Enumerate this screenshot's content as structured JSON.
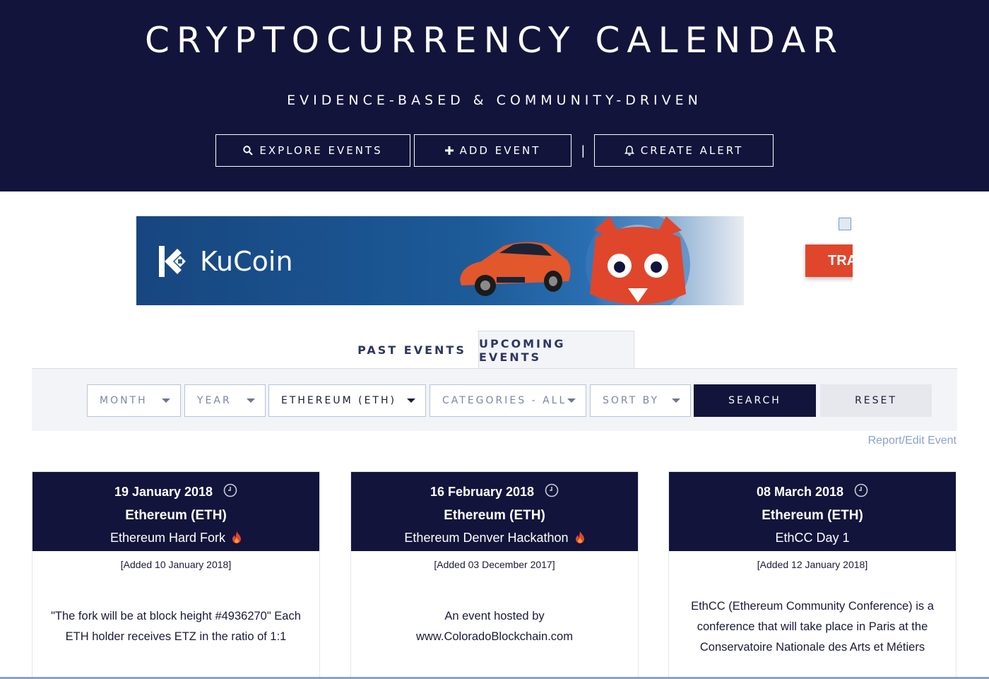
{
  "header": {
    "title": "CRYPTOCURRENCY CALENDAR",
    "subtitle": "EVIDENCE-BASED & COMMUNITY-DRIVEN",
    "buttons": [
      {
        "label": "EXPLORE EVENTS",
        "icon": "search-icon"
      },
      {
        "label": "ADD EVENT",
        "icon": "plus-icon"
      },
      {
        "label": "CREATE ALERT",
        "icon": "bell-icon"
      }
    ],
    "separator": "|",
    "colors": {
      "background": "#13143b",
      "text": "#ffffff"
    }
  },
  "ad": {
    "brand": "KuCoin",
    "cta": "TRA",
    "colors": {
      "blue": "#1c5a98",
      "cta": "#e0462b"
    }
  },
  "tabs": [
    {
      "label": "PAST EVENTS",
      "active": false
    },
    {
      "label": "UPCOMING EVENTS",
      "active": true
    }
  ],
  "filters": {
    "month": "MONTH",
    "year": "YEAR",
    "coin": "ETHEREUM (ETH)",
    "categories": "CATEGORIES - ALL",
    "sort": "SORT BY",
    "search_label": "SEARCH",
    "reset_label": "RESET"
  },
  "report_link": "Report/Edit Event",
  "cards": [
    {
      "date": "19 January 2018",
      "coin": "Ethereum (ETH)",
      "event": "Ethereum Hard Fork",
      "hot": true,
      "added": "[Added 10 January 2018]",
      "description": "\"The fork will be at block height #4936270\" Each ETH holder receives ETZ in the ratio of 1:1"
    },
    {
      "date": "16 February 2018",
      "coin": "Ethereum (ETH)",
      "event": "Ethereum Denver Hackathon",
      "hot": true,
      "added": "[Added 03 December 2017]",
      "description": "An event hosted by www.ColoradoBlockchain.com"
    },
    {
      "date": "08 March 2018",
      "coin": "Ethereum (ETH)",
      "event": "EthCC Day 1",
      "hot": false,
      "added": "[Added 12 January 2018]",
      "description": "EthCC (Ethereum Community Conference) is a conference that will take place in Paris at the Conservatoire Nationale des Arts et Métiers"
    }
  ]
}
